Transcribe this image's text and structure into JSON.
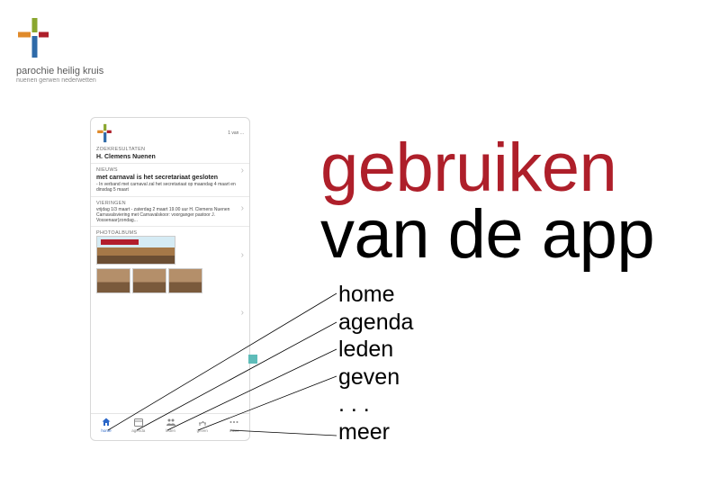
{
  "brand": {
    "title": "parochie heilig kruis",
    "subtitle": "nuenen gerwen nederwetten"
  },
  "headline": {
    "line1": "gebruiken",
    "line2": "van de app"
  },
  "features": {
    "items": [
      "home",
      "agenda",
      "leden",
      "geven",
      ". . .",
      "meer"
    ]
  },
  "phone": {
    "count_label": "1 van ...",
    "section1_label": "zoekresultaten",
    "item1_title": "H. Clemens Nuenen",
    "section2_label": "nieuws",
    "item2_title": "met carnaval is het secretariaat gesloten",
    "item2_body": "- In verband met carnaval zal het secretariaat op maandag 4 maart en dinsdag 5 maart",
    "section3_label": "vieringen",
    "item3_body": "vrijdag 1/3 maart - zaterdag 2 maart 19.00 uur H. Clemens Nuenen Carnavalsviering met Carnavalskoor: voorganger pastoor J. Vossenaar(zondag...",
    "photos_label": "photoalbums"
  },
  "bottombar": {
    "items": [
      {
        "label": "home",
        "icon": "home"
      },
      {
        "label": "agenda",
        "icon": "calendar"
      },
      {
        "label": "leden",
        "icon": "people"
      },
      {
        "label": "geven",
        "icon": "hand"
      },
      {
        "label": "meer",
        "icon": "dots"
      }
    ]
  },
  "colors": {
    "brand_red": "#ae1f2a",
    "cross_green": "#8aa62f",
    "cross_blue": "#2e6aa8",
    "cross_orange": "#e08a2a",
    "accent_teal": "#5ebcb9"
  }
}
